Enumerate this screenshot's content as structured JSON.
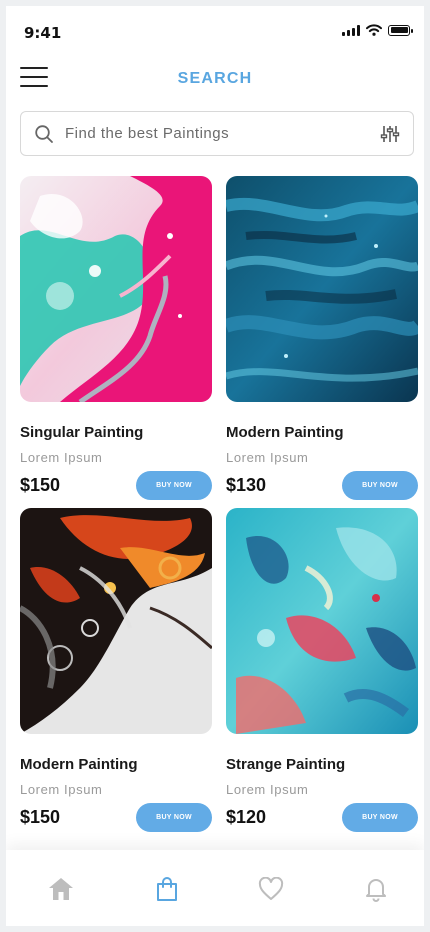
{
  "status_bar": {
    "time": "9:41"
  },
  "header": {
    "title": "SEARCH"
  },
  "search": {
    "placeholder": "Find the best Paintings"
  },
  "products": [
    {
      "title": "Singular Painting",
      "subtitle": "Lorem Ipsum",
      "price": "$150",
      "button": "BUY NOW"
    },
    {
      "title": "Modern Painting",
      "subtitle": "Lorem Ipsum",
      "price": "$130",
      "button": "BUY NOW"
    },
    {
      "title": "Modern Painting",
      "subtitle": "Lorem Ipsum",
      "price": "$150",
      "button": "BUY NOW"
    },
    {
      "title": "Strange Painting",
      "subtitle": "Lorem Ipsum",
      "price": "$120",
      "button": "BUY NOW"
    }
  ],
  "nav": {
    "items": [
      {
        "icon": "home-icon",
        "active": false
      },
      {
        "icon": "shopping-bag-icon",
        "active": true
      },
      {
        "icon": "heart-icon",
        "active": false
      },
      {
        "icon": "bell-icon",
        "active": false
      }
    ]
  },
  "colors": {
    "accent": "#59a6e0",
    "button": "#62abe6",
    "inactive_icon": "#bdbdbd"
  }
}
